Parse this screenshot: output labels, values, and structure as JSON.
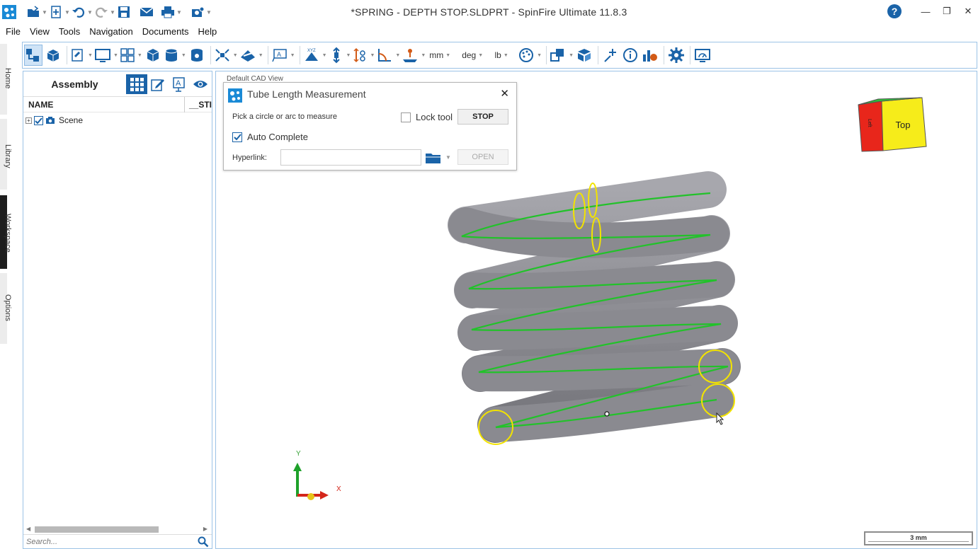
{
  "window": {
    "title": "*SPRING - DEPTH STOP.SLDPRT - SpinFire Ultimate 11.8.3",
    "controls": [
      "minimize",
      "restore",
      "close"
    ]
  },
  "quick_access": [
    "app-logo-icon",
    "open-icon",
    "new-icon",
    "undo-icon",
    "redo-icon",
    "save-icon",
    "email-icon",
    "print-icon",
    "snapshot-icon"
  ],
  "menu": [
    "File",
    "View",
    "Tools",
    "Navigation",
    "Documents",
    "Help"
  ],
  "toolbar": {
    "units": {
      "length": "mm",
      "angle": "deg",
      "mass": "lb"
    }
  },
  "side_tabs": [
    "Home",
    "Library",
    "Workspace",
    "Options"
  ],
  "active_side_tab": "Workspace",
  "panel": {
    "title": "Assembly",
    "columns": [
      "NAME",
      "__STI"
    ],
    "tree": [
      {
        "label": "Scene",
        "checked": true
      }
    ],
    "search_placeholder": "Search..."
  },
  "viewport": {
    "view_name": "Default CAD View",
    "axis_x": "X",
    "axis_y": "Y",
    "cube_labels": {
      "front": "Top",
      "side": "Left"
    },
    "scale": "3 mm"
  },
  "dialog": {
    "title": "Tube Length Measurement",
    "hint": "Pick a circle or arc to measure",
    "lock_label": "Lock tool",
    "lock_checked": false,
    "stop_label": "STOP",
    "auto_complete_label": "Auto Complete",
    "auto_complete_checked": true,
    "hyperlink_label": "Hyperlink:",
    "hyperlink_value": "",
    "open_label": "OPEN"
  },
  "colors": {
    "accent": "#1a63a8",
    "spring": "#8d8d93",
    "path": "#22c22a",
    "selection": "#f2e300"
  }
}
